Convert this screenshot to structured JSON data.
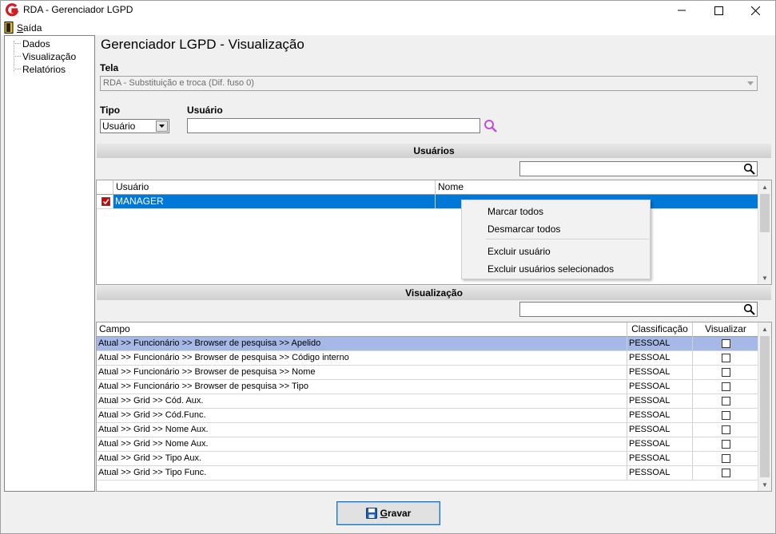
{
  "window": {
    "title": "RDA - Gerenciador LGPD"
  },
  "menu": {
    "exit_label": "Saída"
  },
  "sidebar": {
    "items": [
      {
        "label": "Dados"
      },
      {
        "label": "Visualização"
      },
      {
        "label": "Relatórios"
      }
    ]
  },
  "page": {
    "title": "Gerenciador LGPD - Visualização"
  },
  "screen_field": {
    "label": "Tela",
    "value": "RDA - Substituição e troca (Dif. fuso 0)"
  },
  "type_field": {
    "label": "Tipo",
    "value": "Usuário"
  },
  "user_field": {
    "label": "Usuário",
    "value": ""
  },
  "users_section": {
    "title": "Usuários",
    "columns": [
      "Usuário",
      "Nome"
    ],
    "rows": [
      {
        "checked": true,
        "user": "MANAGER",
        "name": ""
      }
    ]
  },
  "context_menu": {
    "items": [
      "Marcar todos",
      "Desmarcar todos",
      "Excluir usuário",
      "Excluir usuários selecionados"
    ]
  },
  "view_section": {
    "title": "Visualização",
    "columns": [
      "Campo",
      "Classificação",
      "Visualizar"
    ],
    "rows": [
      {
        "campo": "Atual >> Funcionário >> Browser de pesquisa >> Apelido",
        "classificacao": "PESSOAL",
        "visualizar": false
      },
      {
        "campo": "Atual >> Funcionário >> Browser de pesquisa >> Código interno",
        "classificacao": "PESSOAL",
        "visualizar": false
      },
      {
        "campo": "Atual >> Funcionário >> Browser de pesquisa >> Nome",
        "classificacao": "PESSOAL",
        "visualizar": false
      },
      {
        "campo": "Atual >> Funcionário >> Browser de pesquisa >> Tipo",
        "classificacao": "PESSOAL",
        "visualizar": false
      },
      {
        "campo": "Atual >> Grid >> Cód. Aux.",
        "classificacao": "PESSOAL",
        "visualizar": false
      },
      {
        "campo": "Atual >> Grid >> Cód.Func.",
        "classificacao": "PESSOAL",
        "visualizar": false
      },
      {
        "campo": "Atual >> Grid >> Nome Aux.",
        "classificacao": "PESSOAL",
        "visualizar": false
      },
      {
        "campo": "Atual >> Grid >> Nome Aux.",
        "classificacao": "PESSOAL",
        "visualizar": false
      },
      {
        "campo": "Atual >> Grid >> Tipo Aux.",
        "classificacao": "PESSOAL",
        "visualizar": false
      },
      {
        "campo": "Atual >> Grid >> Tipo Func.",
        "classificacao": "PESSOAL",
        "visualizar": false
      }
    ]
  },
  "footer": {
    "save_label": "Gravar"
  },
  "colors": {
    "selection": "#0078d7",
    "row_highlight": "#a5b8e6",
    "logo": "#d71920"
  }
}
